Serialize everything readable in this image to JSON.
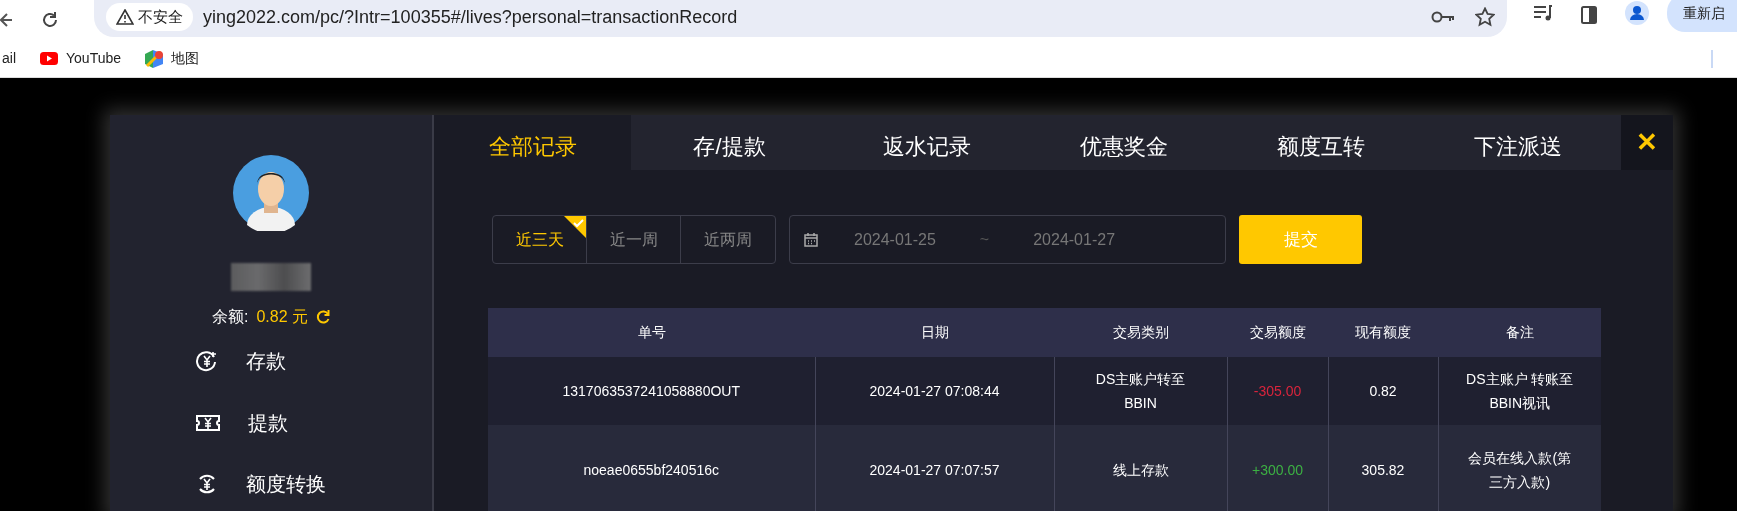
{
  "browser": {
    "security_label": "不安全",
    "url": "ying2022.com/pc/?Intr=100355#/lives?personal=transactionRecord",
    "relaunch_button": "重新启",
    "bookmarks": [
      {
        "label": "ail",
        "kind": "plain"
      },
      {
        "label": "YouTube",
        "kind": "youtube"
      },
      {
        "label": "地图",
        "kind": "maps"
      }
    ]
  },
  "sidebar": {
    "balance_label": "余额:",
    "balance_value": "0.82 元",
    "menu": [
      {
        "label": "存款",
        "kind": "deposit"
      },
      {
        "label": "提款",
        "kind": "withdraw"
      },
      {
        "label": "额度转换",
        "kind": "transfer"
      }
    ]
  },
  "tabs": [
    {
      "label": "全部记录",
      "selected": true
    },
    {
      "label": "存/提款",
      "selected": false
    },
    {
      "label": "返水记录",
      "selected": false
    },
    {
      "label": "优惠奖金",
      "selected": false
    },
    {
      "label": "额度互转",
      "selected": false
    },
    {
      "label": "下注派送",
      "selected": false
    }
  ],
  "close_button": "✕",
  "ranges": [
    {
      "label": "近三天",
      "selected": true
    },
    {
      "label": "近一周",
      "selected": false
    },
    {
      "label": "近两周",
      "selected": false
    }
  ],
  "date_range": {
    "start": "2024-01-25",
    "separator": "~",
    "end": "2024-01-27"
  },
  "submit_button": "提交",
  "table": {
    "columns": [
      "单号",
      "日期",
      "交易类别",
      "交易额度",
      "现有额度",
      "备注"
    ],
    "rows": [
      {
        "id": "1317063537241058880OUT",
        "date": "2024-01-27 07:08:44",
        "type": "DS主账户转至BBIN",
        "amount": "-305.00",
        "color": "#d9243c",
        "balance": "0.82",
        "note": "DS主账户 转账至 BBIN视讯"
      },
      {
        "id": "noeae0655bf240516c",
        "date": "2024-01-27 07:07:57",
        "type": "线上存款",
        "amount": "+300.00",
        "color": "#3cb043",
        "balance": "305.82",
        "note": "会员在线入款(第三方入款)"
      }
    ]
  }
}
